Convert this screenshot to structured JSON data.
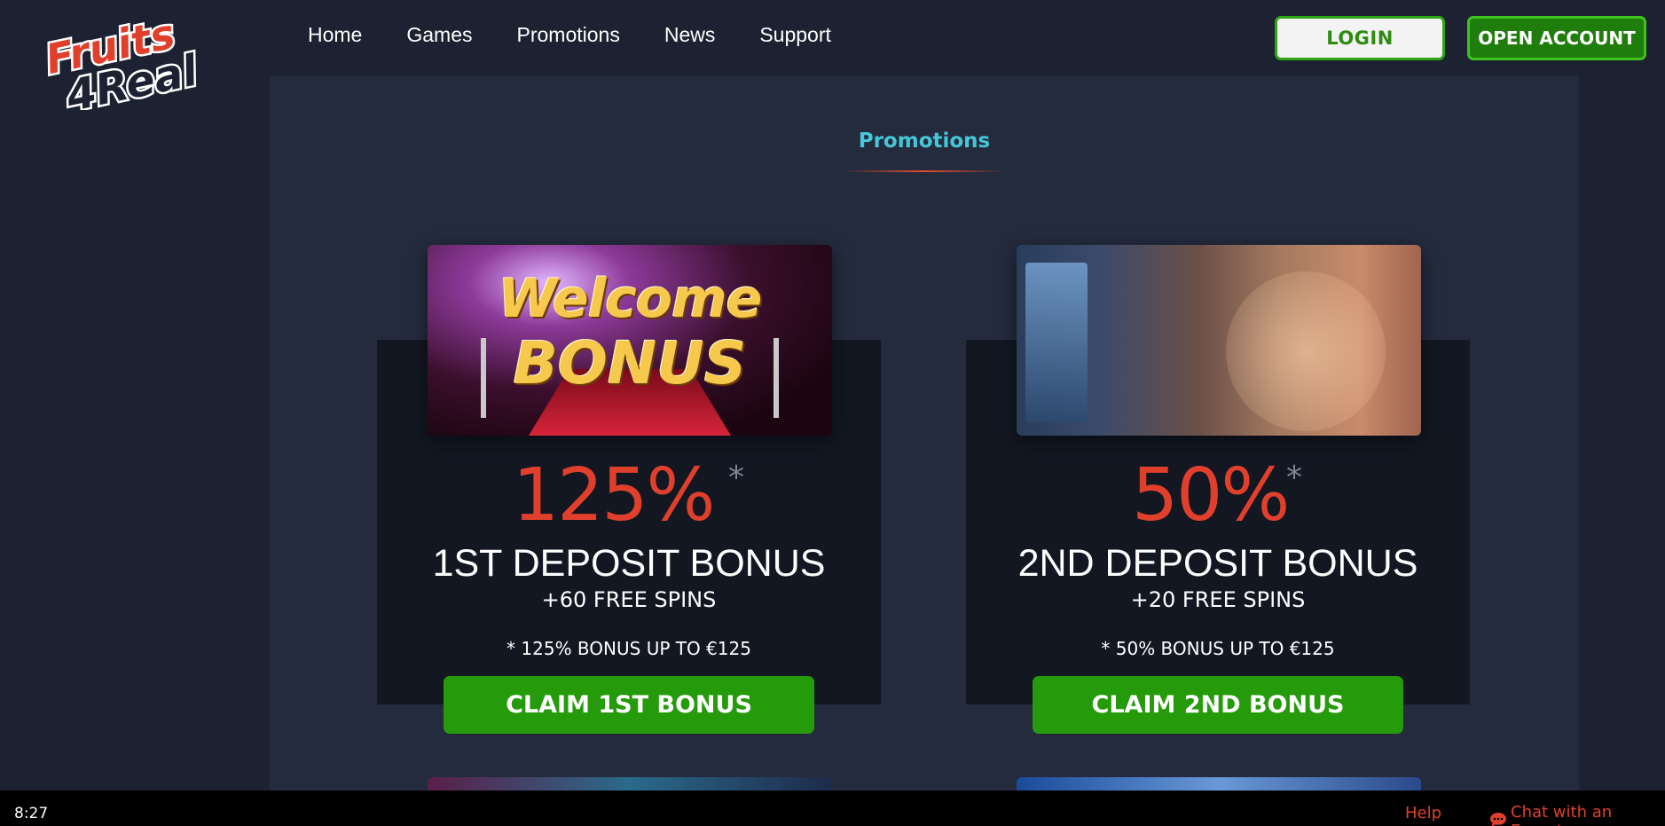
{
  "logo": {
    "line1": "Fruits",
    "line2": "4Real"
  },
  "nav": {
    "items": [
      {
        "label": "Home"
      },
      {
        "label": "Games"
      },
      {
        "label": "Promotions"
      },
      {
        "label": "News"
      },
      {
        "label": "Support"
      }
    ]
  },
  "header": {
    "login_label": "LOGIN",
    "open_account_label": "OPEN ACCOUNT"
  },
  "main": {
    "section_title": "Promotions",
    "cards": [
      {
        "image_text_1": "Welcome",
        "image_text_2": "BONUS",
        "percent": "125%",
        "asterisk": "*",
        "title": "1ST DEPOSIT BONUS",
        "spins": "+60 FREE SPINS",
        "terms": "* 125% BONUS UP TO €125",
        "claim_label": "CLAIM 1ST BONUS"
      },
      {
        "percent": "50%",
        "asterisk": "*",
        "title": "2ND DEPOSIT BONUS",
        "spins": "+20 FREE SPINS",
        "terms": "* 50% BONUS UP TO €125",
        "claim_label": "CLAIM 2ND BONUS"
      }
    ]
  },
  "footer": {
    "clock": "8:27",
    "help_label": "Help",
    "chat_label": "Chat with an Expert"
  },
  "colors": {
    "accent_red": "#e0402b",
    "accent_green": "#259a0a",
    "title_cyan": "#45c7d8",
    "background": "#1c2231"
  }
}
